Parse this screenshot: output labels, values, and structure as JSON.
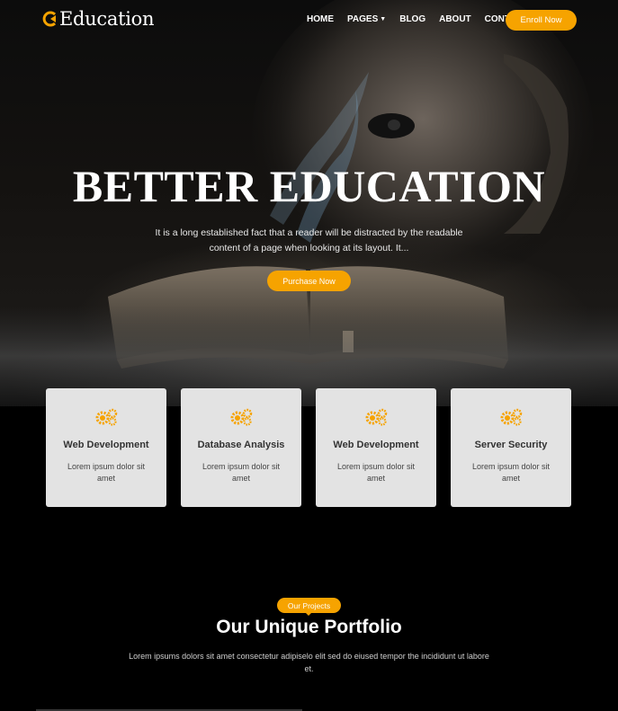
{
  "brand": {
    "name": "Education",
    "accent_color": "#f6a300"
  },
  "nav": {
    "items": [
      {
        "label": "HOME"
      },
      {
        "label": "PAGES",
        "has_dropdown": true,
        "icon": "chevron-down-icon"
      },
      {
        "label": "BLOG"
      },
      {
        "label": "ABOUT"
      },
      {
        "label": "CONTACT"
      }
    ],
    "cta_label": "Enroll Now"
  },
  "hero": {
    "title": "BETTER EDUCATION",
    "subtitle": "It is a long established fact that a reader will be distracted by the readable content of a page when looking at its layout. It...",
    "button_label": "Purchase Now"
  },
  "services": [
    {
      "icon": "gears-icon",
      "title": "Web Development",
      "text": "Lorem ipsum dolor sit amet"
    },
    {
      "icon": "gears-icon",
      "title": "Database Analysis",
      "text": "Lorem ipsum dolor sit amet"
    },
    {
      "icon": "gears-icon",
      "title": "Web Development",
      "text": "Lorem ipsum dolor sit amet"
    },
    {
      "icon": "gears-icon",
      "title": "Server Security",
      "text": "Lorem ipsum dolor sit amet"
    }
  ],
  "portfolio": {
    "badge": "Our Projects",
    "title": "Our Unique Portfolio",
    "text": "Lorem ipsums dolors sit amet consectetur adipiselo elit sed do eiused tempor the incididunt ut labore et."
  }
}
